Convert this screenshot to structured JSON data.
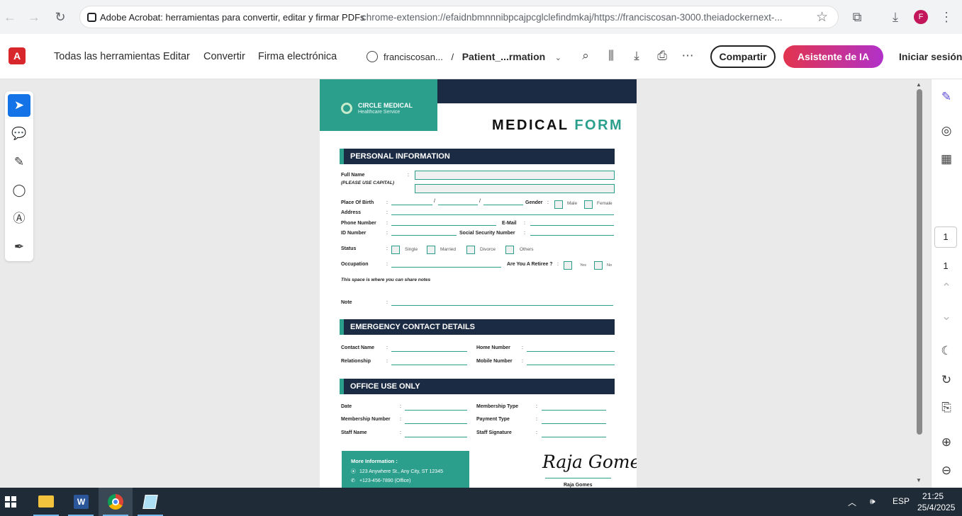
{
  "browser": {
    "tab_title": "Adobe Acrobat: herramientas para convertir, editar y firmar PDFs",
    "url": "chrome-extension://efaidnbmnnnibpcajpcglclefindmkaj/https://franciscosan-3000.theiadockernext-...",
    "profile_initial": "F",
    "icons": {
      "back": "back-arrow-icon",
      "forward": "forward-arrow-icon",
      "reload": "reload-icon",
      "star": "bookmark-star-icon",
      "extensions": "extensions-icon",
      "downloads": "download-icon",
      "menu": "kebab-menu-icon"
    }
  },
  "acrobat": {
    "menu": [
      "Todas las herramientas",
      "Editar",
      "Convertir",
      "Firma electrónica"
    ],
    "breadcrumb": {
      "location": "franciscosan...",
      "separator": "/",
      "file": "Patient_...rmation"
    },
    "share_label": "Compartir",
    "ai_label": "Asistente de IA",
    "signin_label": "Iniciar sesión",
    "page_current": "1",
    "page_total": "1",
    "accent_color": "#1473e6"
  },
  "form": {
    "brand_name": "CIRCLE MEDICAL",
    "brand_sub": "Healthcare Service",
    "title_part1": "MEDICAL",
    "title_part2": "FORM",
    "colon": ":",
    "slash": "/",
    "personal": {
      "heading": "PERSONAL INFORMATION",
      "full_name": "Full Name",
      "please_capital": "(PLEASE USE CAPITAL)",
      "place_of_birth": "Place Of Birth",
      "gender": "Gender",
      "male": "Male",
      "female": "Female",
      "address": "Address",
      "phone": "Phone Number",
      "email": "E-Mail",
      "id_number": "ID Number",
      "ssn": "Social Security Number",
      "status": "Status",
      "single": "Single",
      "married": "Married",
      "divorce": "Divorce",
      "others": "Others",
      "occupation": "Occupation",
      "retiree": "Are You A Retiree ?",
      "yes": "Yes",
      "no": "No",
      "notes_hint": "This space is where you can share notes",
      "note": "Note"
    },
    "emergency": {
      "heading": "EMERGENCY CONTACT DETAILS",
      "contact_name": "Contact Name",
      "home_number": "Home Number",
      "relationship": "Relationship",
      "mobile_number": "Mobile Number"
    },
    "office": {
      "heading": "OFFICE USE ONLY",
      "date": "Date",
      "membership_type": "Membership Type",
      "membership_number": "Membership Number",
      "payment_type": "Payment Type",
      "staff_name": "Staff Name",
      "staff_signature": "Staff Signature"
    },
    "more_info": {
      "title": "More Information :",
      "address": "123 Anywhere St., Any City, ST 12345",
      "phone": "+123-456-7890 (Office)"
    },
    "signature_script": "Raja Gomes",
    "signature_name": "Raja Gomes",
    "colors": {
      "teal": "#2b9e8c",
      "navy": "#1b2b43"
    }
  },
  "taskbar": {
    "apps": [
      "file-explorer",
      "word",
      "chrome",
      "notepad"
    ],
    "language": "ESP",
    "time": "21:25",
    "date": "25/4/2025"
  }
}
